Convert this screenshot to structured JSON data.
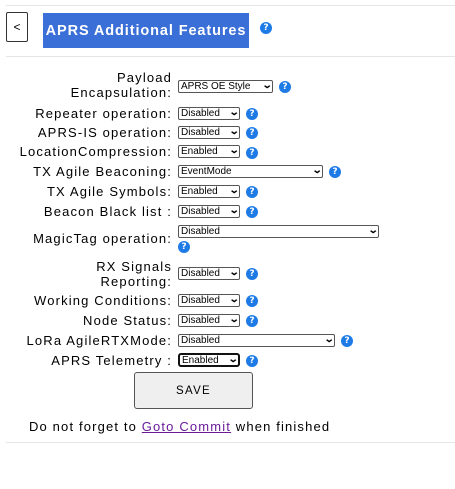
{
  "header": {
    "back_label": "<",
    "title": "APRS Additional Features",
    "help_glyph": "?"
  },
  "form": {
    "rows": [
      {
        "label_line1": "Payload",
        "label_line2": "Encapsulation:",
        "value": "APRS OE Style"
      },
      {
        "label": "Repeater operation:",
        "value": "Disabled"
      },
      {
        "label": "APRS-IS operation:",
        "value": "Disabled"
      },
      {
        "label": "LocationCompression:",
        "value": "Enabled"
      },
      {
        "label": "TX Agile Beaconing:",
        "value": "EventMode"
      },
      {
        "label": "TX Agile Symbols:",
        "value": "Enabled"
      },
      {
        "label": "Beacon Black list :",
        "value": "Disabled"
      },
      {
        "label": "MagicTag operation:",
        "value": "Disabled"
      },
      {
        "label_line1": "RX Signals",
        "label_line2": "Reporting:",
        "value": "Disabled"
      },
      {
        "label": "Working Conditions:",
        "value": "Disabled"
      },
      {
        "label": "Node Status:",
        "value": "Disabled"
      },
      {
        "label": "LoRa AgileRTXMode:",
        "value": "Disabled"
      },
      {
        "label": "APRS Telemetry :",
        "value": "Enabled"
      }
    ],
    "save_label": "SAVE"
  },
  "footer": {
    "note_before": "Do not forget to ",
    "link_text": "Goto Commit",
    "note_after": " when finished"
  },
  "colors": {
    "title_bg": "#3a6fd8",
    "help_icon": "#1e7be6",
    "link": "#6a1b9a"
  }
}
